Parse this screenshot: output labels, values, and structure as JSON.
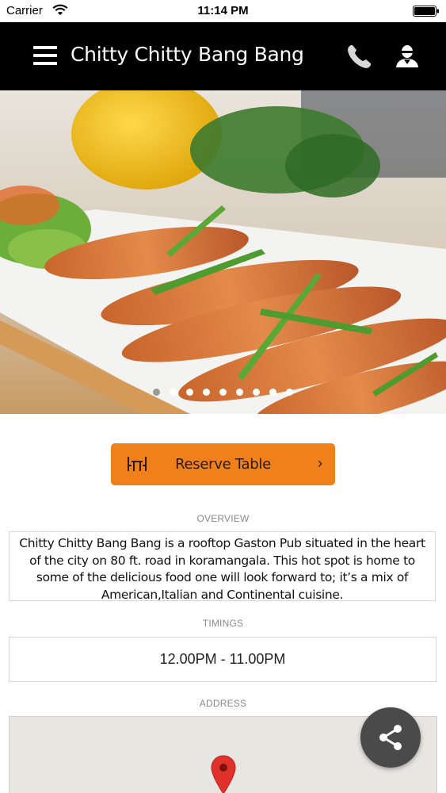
{
  "status_bar": {
    "carrier": "Carrier",
    "time": "11:14 PM"
  },
  "app_bar": {
    "title": "Chitty Chitty Bang Bang",
    "background": "#000000",
    "icons": [
      "menu-icon",
      "phone-icon",
      "profile-icon"
    ]
  },
  "carousel": {
    "total_slides": 9,
    "active_index": 0
  },
  "reserve": {
    "label": "Reserve Table",
    "chevron": "›",
    "color": "#f08019"
  },
  "overview": {
    "label": "OVERVIEW",
    "text": "Chitty Chitty Bang Bang is a rooftop Gaston Pub situated in the heart of the city on 80 ft. road in koramangala. This hot spot is home to some of the delicious food one will look forward to; it’s a mix of American,Italian and Continental cuisine."
  },
  "timings": {
    "label": "TIMINGS",
    "value": "12.00PM - 11.00PM"
  },
  "address": {
    "label": "ADDRESS"
  },
  "share": {
    "icon": "share-icon"
  }
}
